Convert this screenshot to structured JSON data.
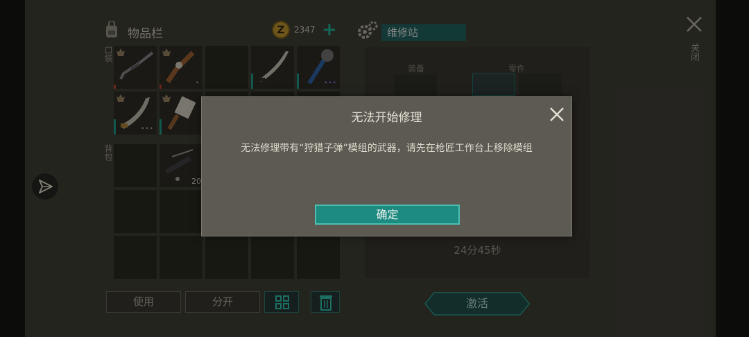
{
  "inventory": {
    "title": "物品栏",
    "coin_icon_glyph": "Z",
    "coins": "2347",
    "add_coins_glyph": "+",
    "pocket_label": "口袋",
    "backpack_label": "背包",
    "stack_count": "20",
    "use_label": "使用",
    "split_label": "分开"
  },
  "repair": {
    "title": "维修站",
    "equipment_label": "装备",
    "parts_label": "零件",
    "timer": "24分45秒",
    "activate_label": "激活"
  },
  "window": {
    "close_label": "关闭"
  },
  "dialog": {
    "title": "无法开始修理",
    "message": "无法修理带有“狩猎子弹”模组的武器，请先在枪匠工作台上移除模组",
    "confirm_label": "确定"
  },
  "colors": {
    "accent_teal": "#1e8b80",
    "durability_bar": "#1a8f7e",
    "low_durability": "#a83a2c"
  }
}
